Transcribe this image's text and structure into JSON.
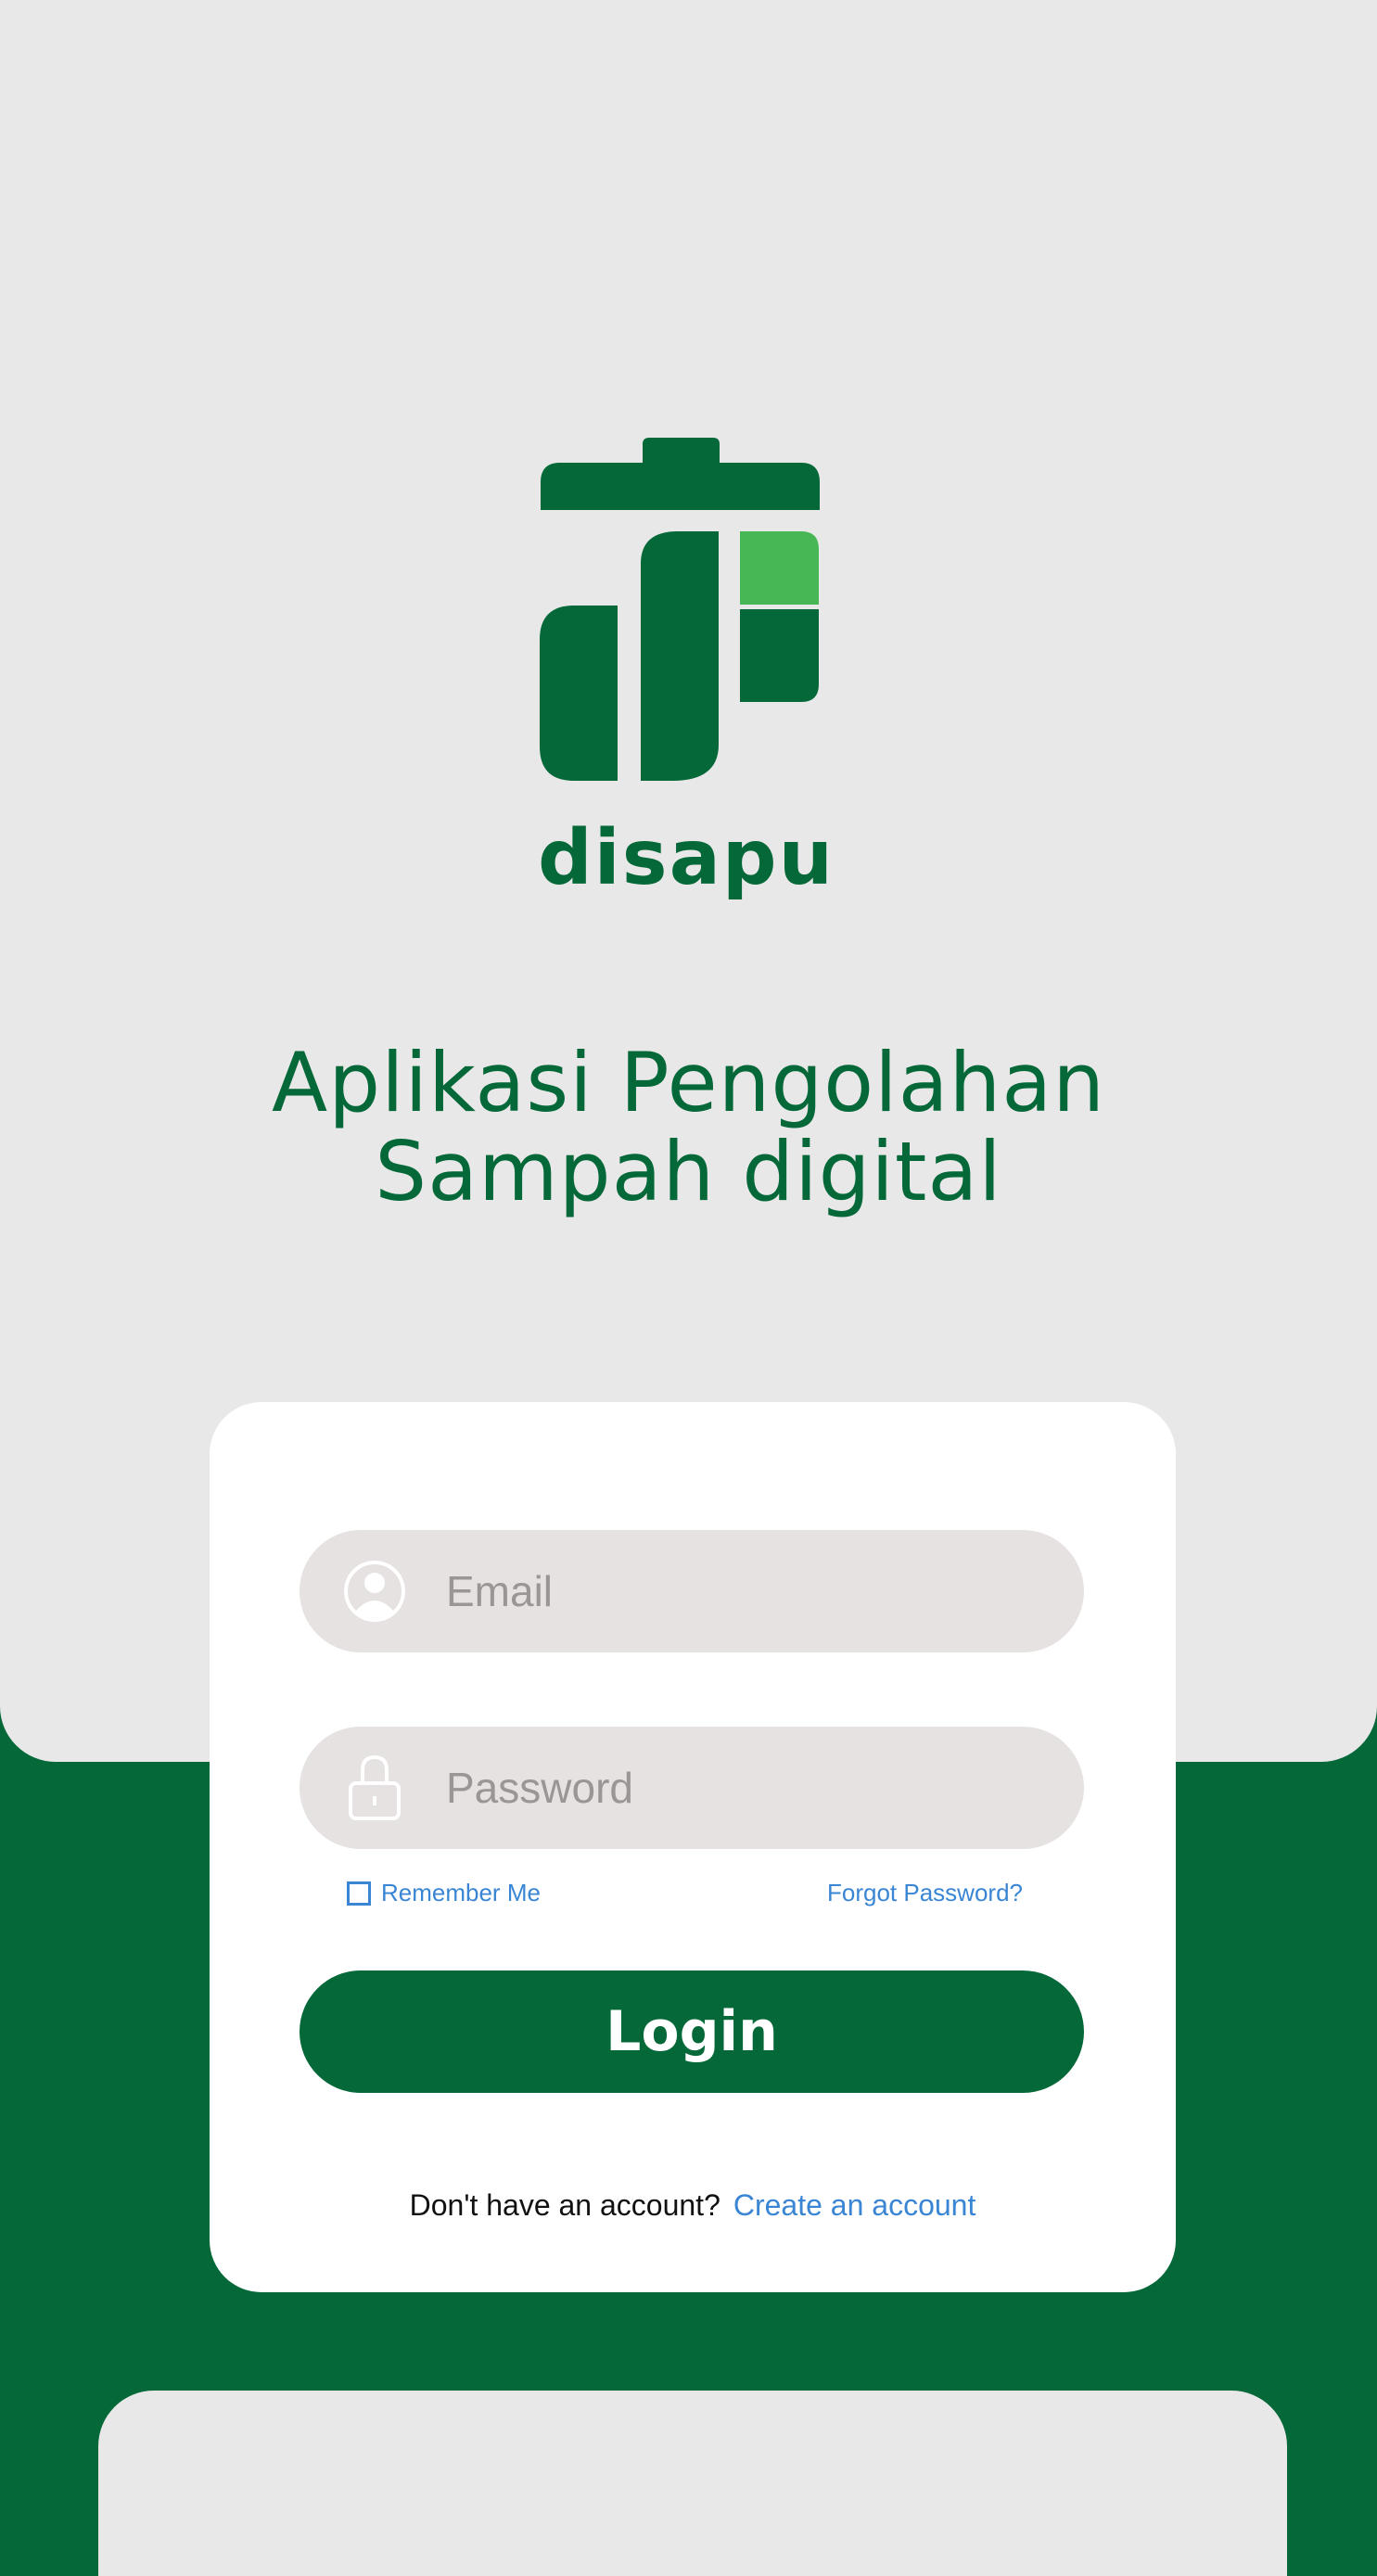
{
  "logo": {
    "wordmark": "disapu",
    "colors": {
      "dark": "#056839",
      "light": "#47b755"
    }
  },
  "header": {
    "title_line1": "Aplikasi Pengolahan",
    "title_line2": "Sampah digital"
  },
  "form": {
    "email": {
      "placeholder": "Email",
      "value": "",
      "icon": "user-circle-icon"
    },
    "password": {
      "placeholder": "Password",
      "value": "",
      "icon": "lock-icon"
    },
    "remember_label": "Remember Me",
    "remember_checked": false,
    "forgot_label": "Forgot Password?",
    "login_label": "Login",
    "signup_prompt": "Don't have an account?",
    "signup_link": "Create an account"
  },
  "colors": {
    "brand": "#056839",
    "link": "#3a86d4",
    "background": "#e8e8e8"
  }
}
